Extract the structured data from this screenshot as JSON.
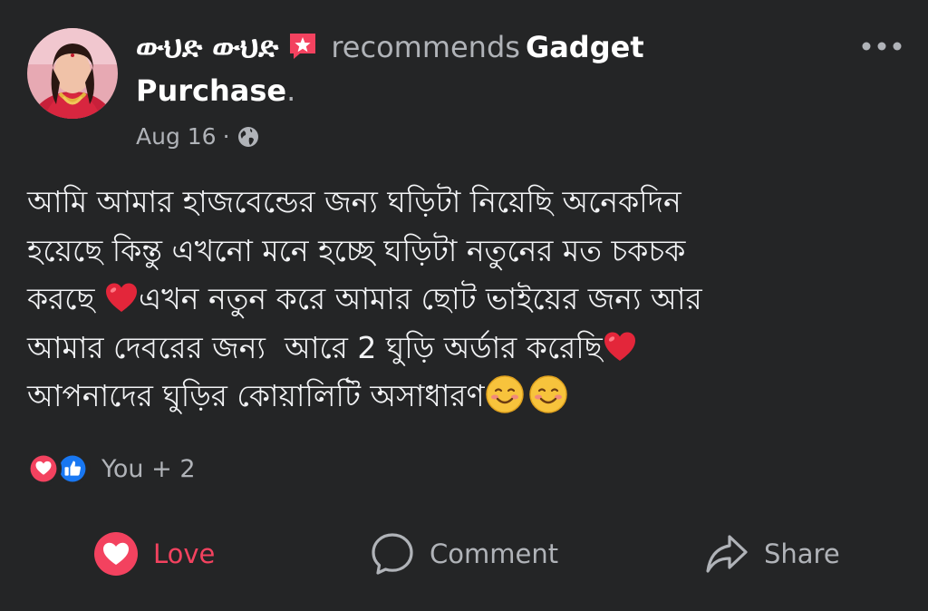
{
  "post": {
    "author": "ውህድ ውህድ",
    "verb": "recommends",
    "page_first": "Gadget",
    "page_second": "Purchase",
    "page_end": ".",
    "date": "Aug 16",
    "separator": "·",
    "body_lines": [
      "আমি আমার হাজবেন্ডের জন্য ঘড়িটা নিয়েছি অনেকদিন",
      "হয়েছে কিন্তু এখনো মনে হচ্ছে ঘড়িটা নতুনের মত চকচক",
      "করছে ",
      "এখন নতুন করে আমার ছোট ভাইয়ের জন্য আর",
      "আমার দেবরের জন্য  আরে 2 ঘুড়ি অর্ডার করেছি",
      "আপনাদের ঘুড়ির কোয়ালিটি অসাধারণ"
    ]
  },
  "reactions": {
    "count_text": "You + 2",
    "icons": [
      "love-reaction-icon",
      "like-reaction-icon"
    ]
  },
  "actions": {
    "love_label": "Love",
    "comment_label": "Comment",
    "share_label": "Share"
  },
  "colors": {
    "background": "#242526",
    "love": "#f3425f",
    "like": "#1877f2",
    "secondary_text": "#b0b3b8"
  }
}
